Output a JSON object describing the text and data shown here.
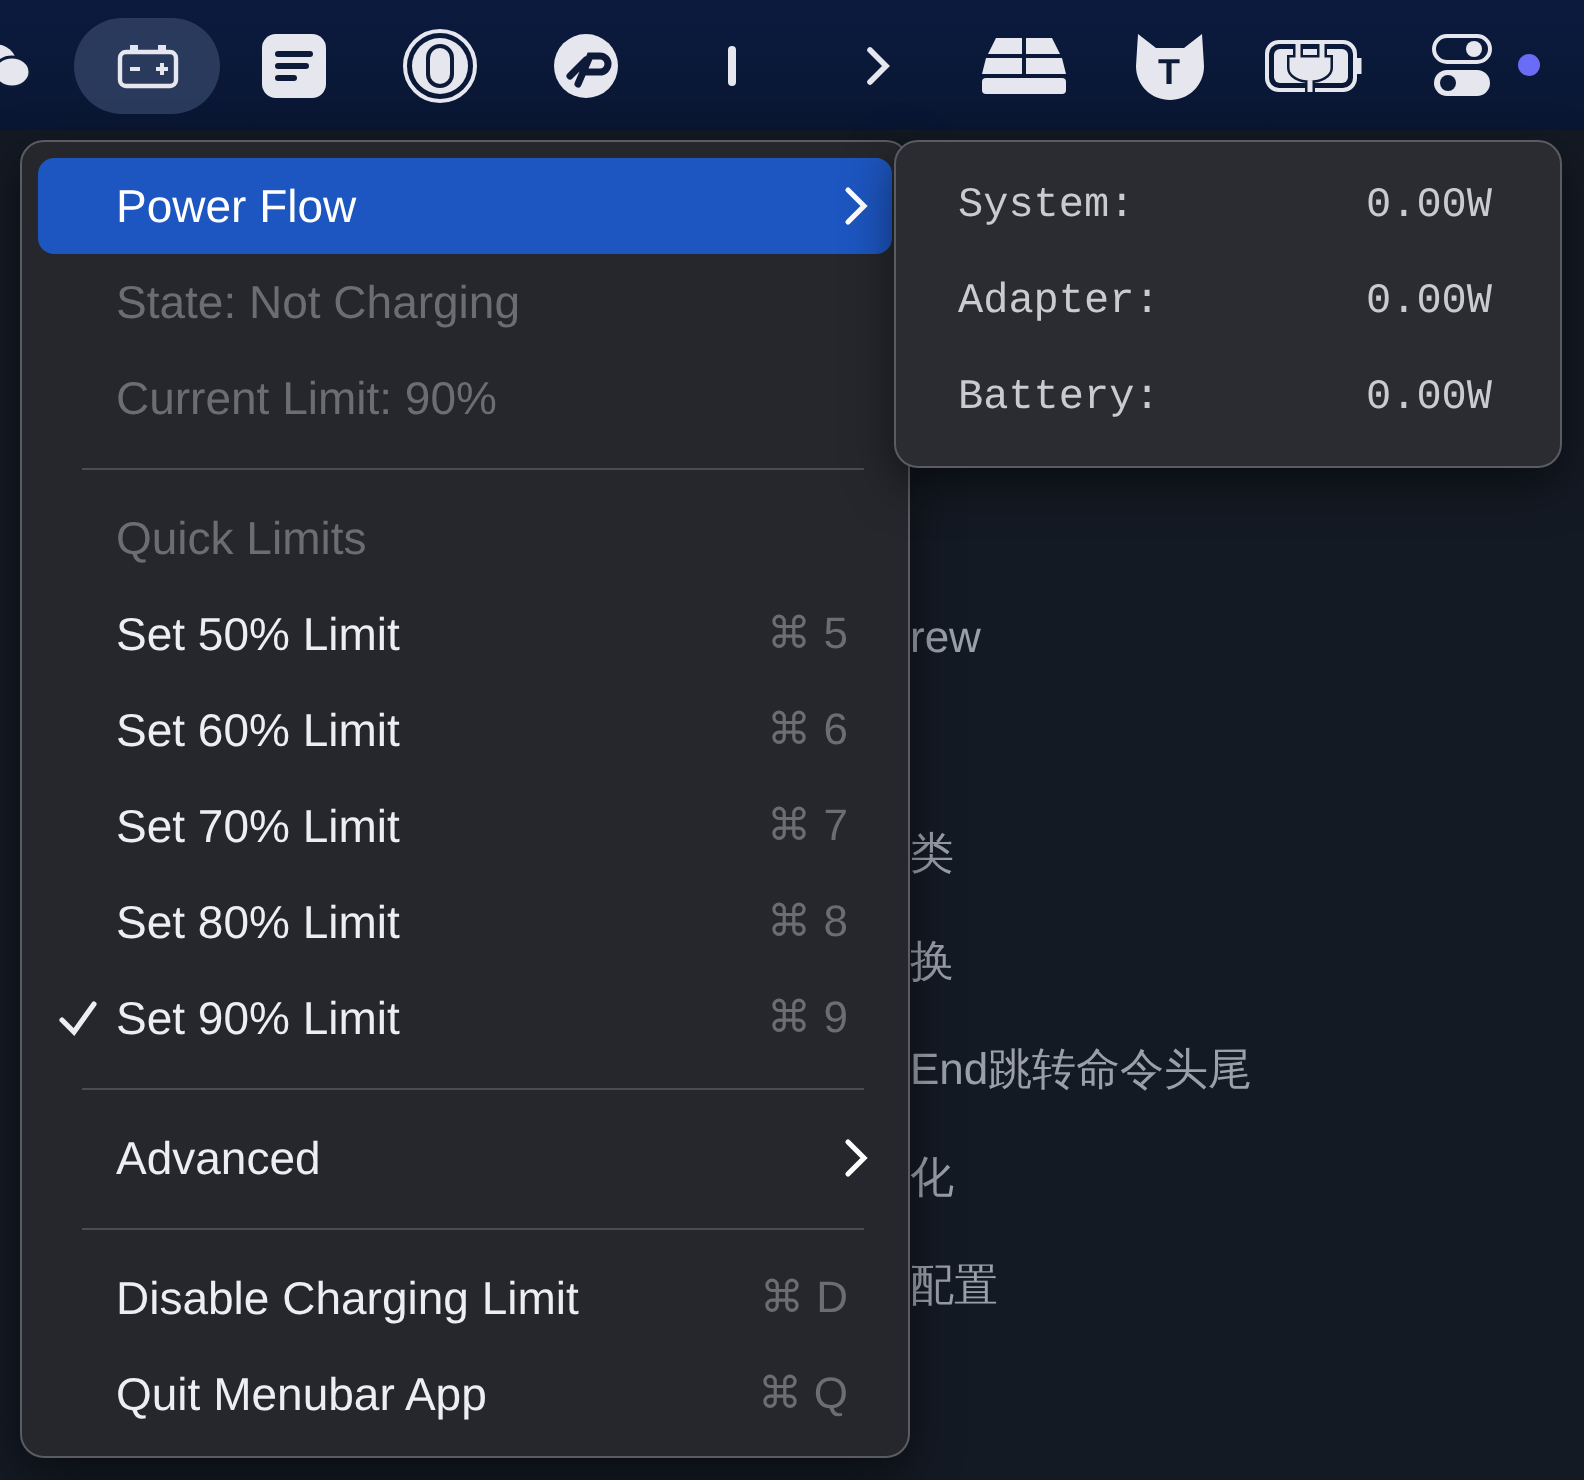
{
  "menubar": {
    "items": [
      {
        "kind": "chat",
        "selected": false
      },
      {
        "kind": "battery",
        "selected": true
      },
      {
        "kind": "note",
        "selected": false
      },
      {
        "kind": "mouse",
        "selected": false
      },
      {
        "kind": "logo",
        "selected": false
      },
      {
        "kind": "bar",
        "selected": false
      },
      {
        "kind": "chevron",
        "selected": false
      },
      {
        "kind": "stack",
        "selected": false
      },
      {
        "kind": "cat",
        "selected": false,
        "letter": "T"
      },
      {
        "kind": "plug",
        "selected": false
      },
      {
        "kind": "toggles",
        "selected": false
      }
    ],
    "status_dot": {
      "color": "#6b6cf5"
    }
  },
  "background": {
    "lines": [
      "rew",
      "类",
      "换",
      "End跳转命令头尾",
      "化",
      "配置"
    ]
  },
  "menu": {
    "items": [
      {
        "kind": "submenu",
        "label": "Power Flow",
        "selected": true
      },
      {
        "kind": "info",
        "label": "State: Not Charging"
      },
      {
        "kind": "info",
        "label": "Current Limit: 90%"
      },
      {
        "kind": "separator"
      },
      {
        "kind": "header",
        "label": "Quick Limits"
      },
      {
        "kind": "item",
        "label": "Set 50% Limit",
        "shortcut": "⌘ 5",
        "checked": false
      },
      {
        "kind": "item",
        "label": "Set 60% Limit",
        "shortcut": "⌘ 6",
        "checked": false
      },
      {
        "kind": "item",
        "label": "Set 70% Limit",
        "shortcut": "⌘ 7",
        "checked": false
      },
      {
        "kind": "item",
        "label": "Set 80% Limit",
        "shortcut": "⌘ 8",
        "checked": false
      },
      {
        "kind": "item",
        "label": "Set 90% Limit",
        "shortcut": "⌘ 9",
        "checked": true
      },
      {
        "kind": "separator"
      },
      {
        "kind": "submenu",
        "label": "Advanced",
        "selected": false
      },
      {
        "kind": "separator"
      },
      {
        "kind": "item",
        "label": "Disable Charging Limit",
        "shortcut": "⌘ D",
        "checked": false
      },
      {
        "kind": "item",
        "label": "Quit Menubar App",
        "shortcut": "⌘ Q",
        "checked": false
      }
    ]
  },
  "submenu": {
    "rows": [
      {
        "label": "System:",
        "value": "0.00W"
      },
      {
        "label": "Adapter:",
        "value": "0.00W"
      },
      {
        "label": "Battery:",
        "value": "0.00W"
      }
    ]
  }
}
